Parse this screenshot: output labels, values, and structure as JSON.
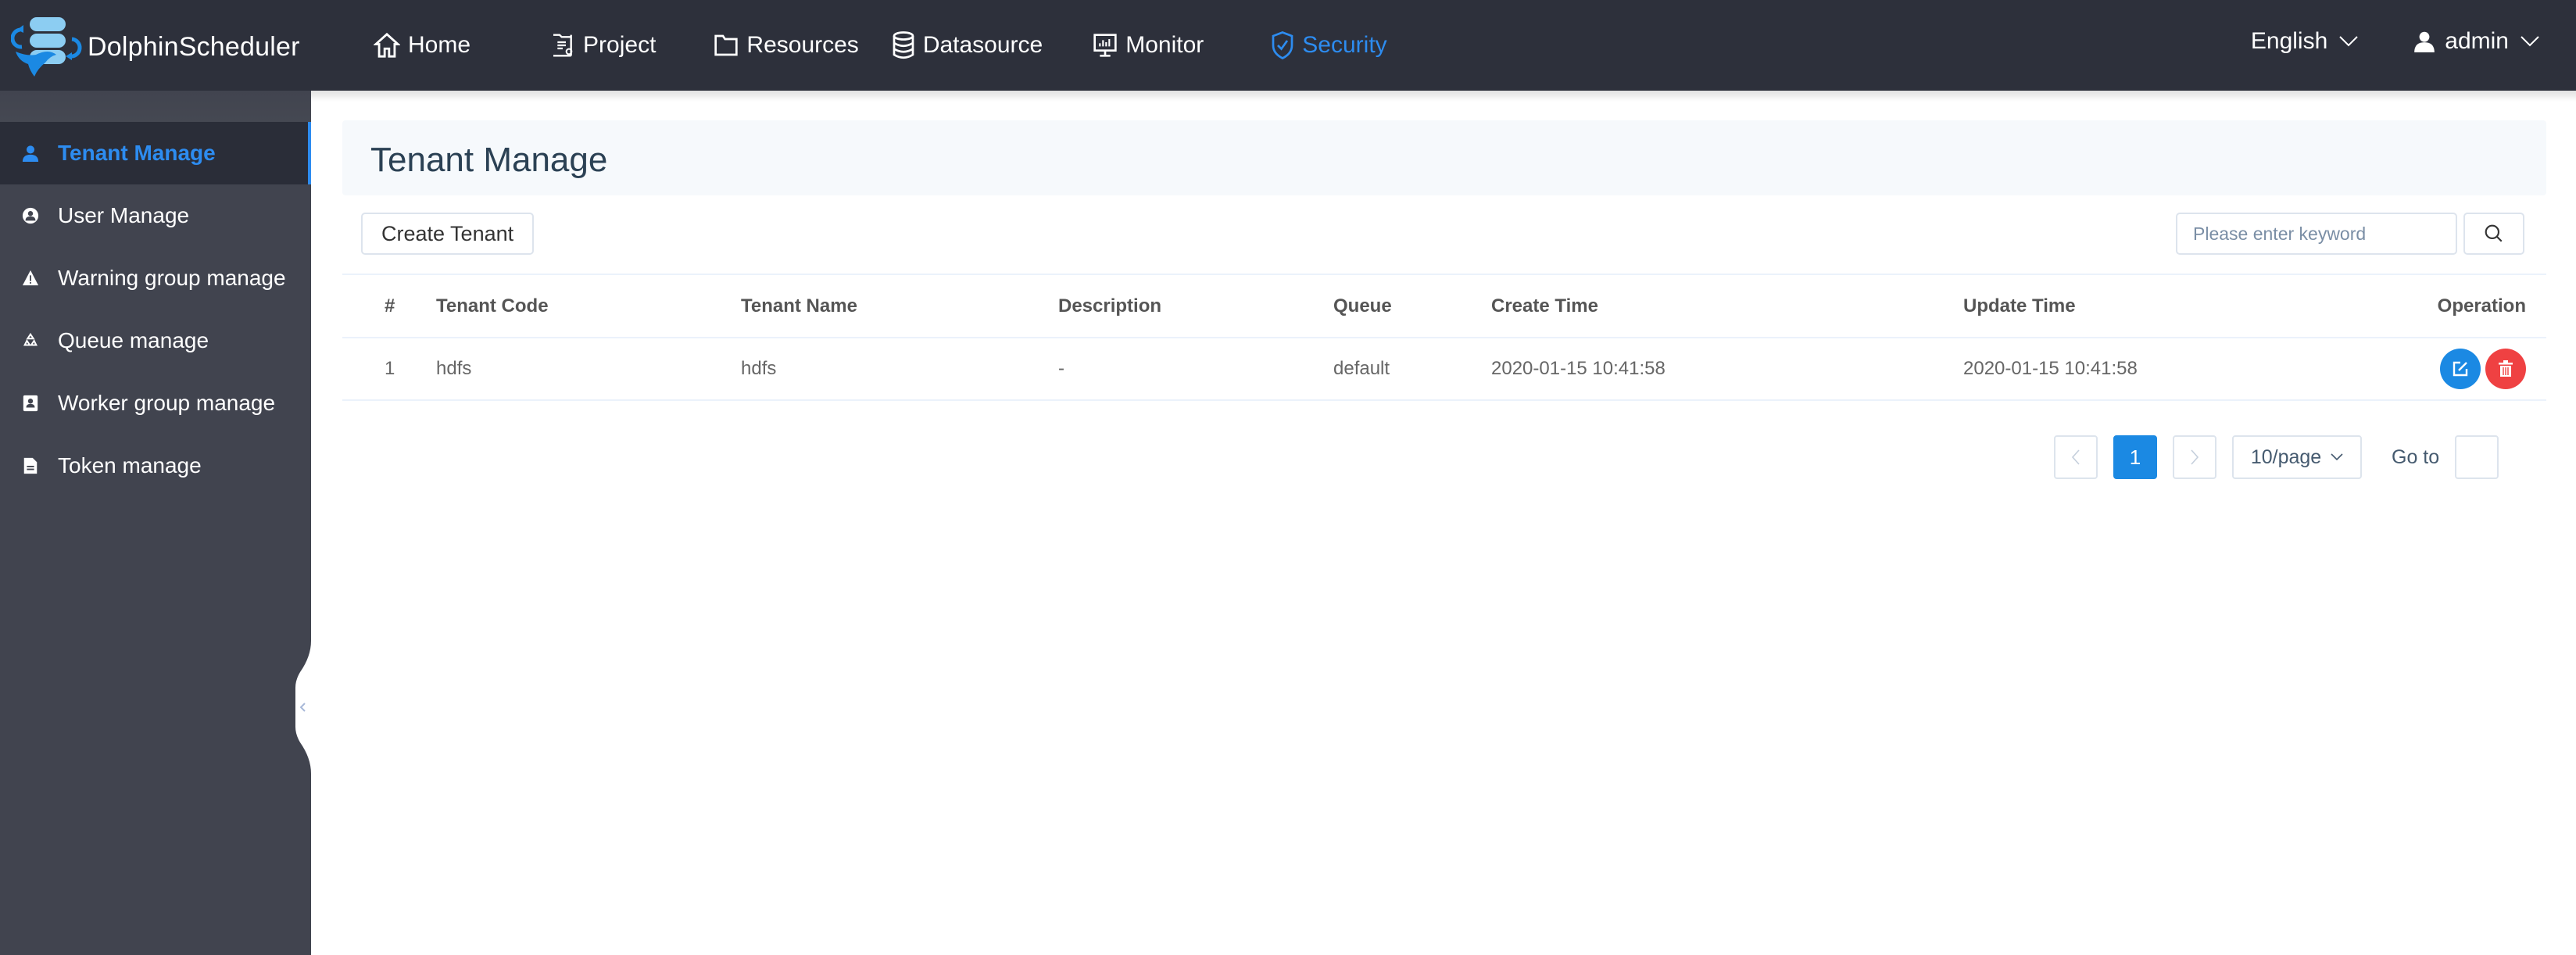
{
  "app": {
    "name": "DolphinScheduler",
    "accent_color": "#2d8cf0"
  },
  "nav": {
    "items": [
      {
        "label": "Home",
        "icon": "home-icon"
      },
      {
        "label": "Project",
        "icon": "project-icon"
      },
      {
        "label": "Resources",
        "icon": "folder-icon"
      },
      {
        "label": "Datasource",
        "icon": "database-icon"
      },
      {
        "label": "Monitor",
        "icon": "monitor-icon"
      },
      {
        "label": "Security",
        "icon": "shield-check-icon",
        "active": true
      }
    ]
  },
  "header_right": {
    "language": "English",
    "user": "admin"
  },
  "sidebar": {
    "items": [
      {
        "label": "Tenant Manage",
        "icon": "user-icon",
        "active": true
      },
      {
        "label": "User Manage",
        "icon": "user-circle-icon"
      },
      {
        "label": "Warning group manage",
        "icon": "warning-icon"
      },
      {
        "label": "Queue manage",
        "icon": "recycle-icon"
      },
      {
        "label": "Worker group manage",
        "icon": "contact-card-icon"
      },
      {
        "label": "Token manage",
        "icon": "file-icon"
      }
    ]
  },
  "page": {
    "title": "Tenant Manage",
    "create_button": "Create Tenant",
    "search_placeholder": "Please enter keyword",
    "search_value": ""
  },
  "table": {
    "columns": [
      "#",
      "Tenant Code",
      "Tenant Name",
      "Description",
      "Queue",
      "Create Time",
      "Update Time",
      "Operation"
    ],
    "rows": [
      {
        "index": "1",
        "tenant_code": "hdfs",
        "tenant_name": "hdfs",
        "description": "-",
        "queue": "default",
        "create_time": "2020-01-15 10:41:58",
        "update_time": "2020-01-15 10:41:58",
        "actions": [
          "edit-icon",
          "delete-icon"
        ]
      }
    ]
  },
  "pagination": {
    "current_page": "1",
    "page_size": "10/page",
    "goto_label": "Go to",
    "goto_value": ""
  },
  "colors": {
    "header_bg": "#2d303b",
    "sidebar_bg": "#41444f",
    "active_item_bg": "#2a2d38",
    "edit_button": "#1b89e3",
    "delete_button": "#ef4142"
  }
}
